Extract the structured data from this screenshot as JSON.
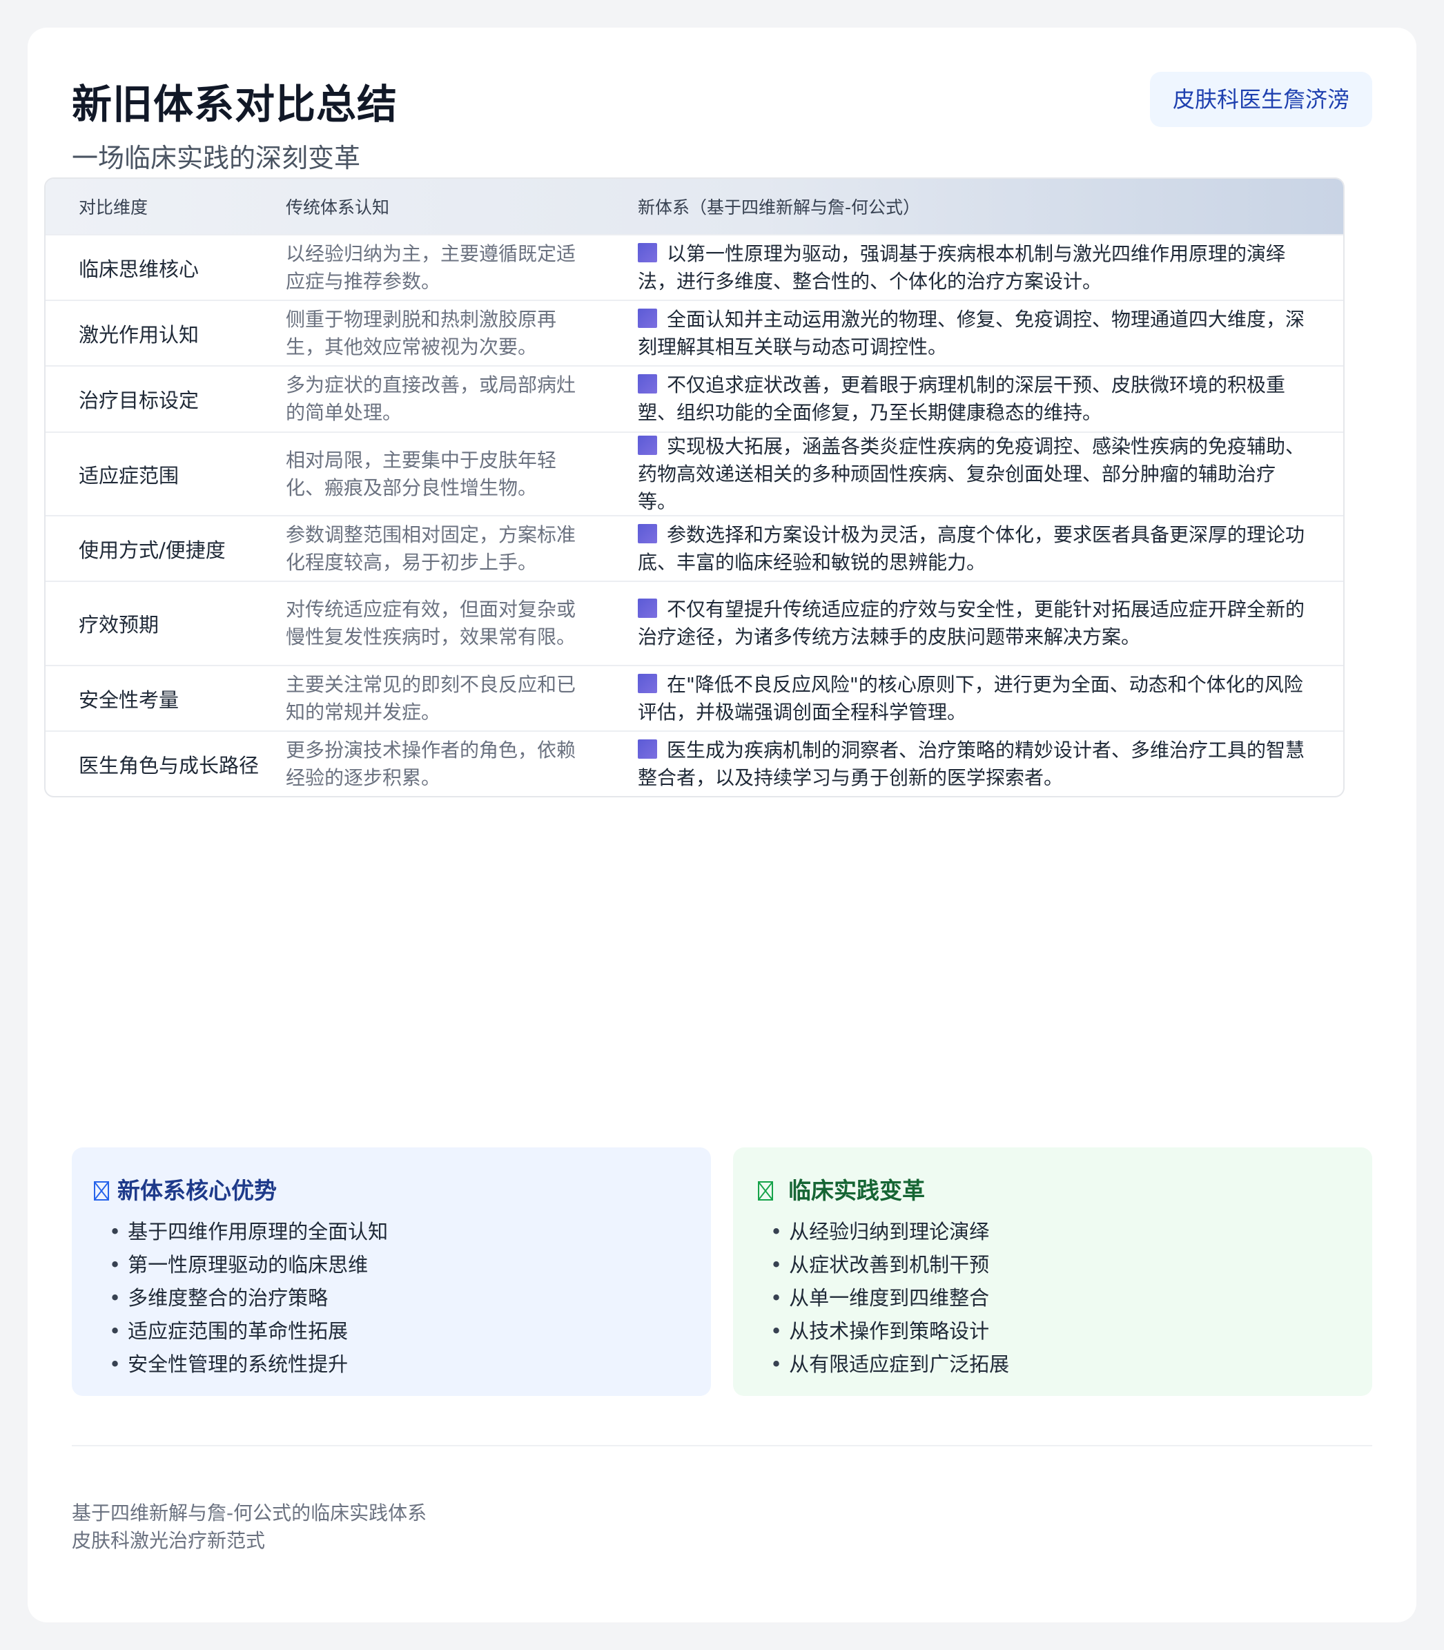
{
  "header": {
    "title": "新旧体系对比总结",
    "subtitle": "一场临床实践的深刻变革",
    "badge": "皮肤科医生詹济滂"
  },
  "table": {
    "columns": [
      "对比维度",
      "传统体系认知",
      "新体系（基于四维新解与詹-何公式）"
    ],
    "rows": [
      {
        "dimension": "临床思维核心",
        "traditional": "以经验归纳为主，主要遵循既定适应症与推荐参数。",
        "new": "以第一性原理为驱动，强调基于疾病根本机制与激光四维作用原理的演绎法，进行多维度、整合性的、个体化的治疗方案设计。"
      },
      {
        "dimension": "激光作用认知",
        "traditional": "侧重于物理剥脱和热刺激胶原再生，其他效应常被视为次要。",
        "new": "全面认知并主动运用激光的物理、修复、免疫调控、物理通道四大维度，深刻理解其相互关联与动态可调控性。"
      },
      {
        "dimension": "治疗目标设定",
        "traditional": "多为症状的直接改善，或局部病灶的简单处理。",
        "new": "不仅追求症状改善，更着眼于病理机制的深层干预、皮肤微环境的积极重塑、组织功能的全面修复，乃至长期健康稳态的维持。"
      },
      {
        "dimension": "适应症范围",
        "traditional": "相对局限，主要集中于皮肤年轻化、瘢痕及部分良性增生物。",
        "new": "实现极大拓展，涵盖各类炎症性疾病的免疫调控、感染性疾病的免疫辅助、药物高效递送相关的多种顽固性疾病、复杂创面处理、部分肿瘤的辅助治疗等。"
      },
      {
        "dimension": "使用方式/便捷度",
        "traditional": "参数调整范围相对固定，方案标准化程度较高，易于初步上手。",
        "new": "参数选择和方案设计极为灵活，高度个体化，要求医者具备更深厚的理论功底、丰富的临床经验和敏锐的思辨能力。"
      },
      {
        "dimension": "疗效预期",
        "traditional": "对传统适应症有效，但面对复杂或慢性复发性疾病时，效果常有限。",
        "new": "不仅有望提升传统适应症的疗效与安全性，更能针对拓展适应症开辟全新的治疗途径，为诸多传统方法棘手的皮肤问题带来解决方案。"
      },
      {
        "dimension": "安全性考量",
        "traditional": "主要关注常见的即刻不良反应和已知的常规并发症。",
        "new": "在\"降低不良反应风险\"的核心原则下，进行更为全面、动态和个体化的风险评估，并极端强调创面全程科学管理。"
      },
      {
        "dimension": "医生角色与成长路径",
        "traditional": "更多扮演技术操作者的角色，依赖经验的逐步积累。",
        "new": "医生成为疾病机制的洞察者、治疗策略的精妙设计者、多维治疗工具的智慧整合者，以及持续学习与勇于创新的医学探索者。"
      }
    ]
  },
  "advantages": {
    "title": "新体系核心优势",
    "items": [
      "基于四维作用原理的全面认知",
      "第一性原理驱动的临床思维",
      "多维度整合的治疗策略",
      "适应症范围的革命性拓展",
      "安全性管理的系统性提升"
    ]
  },
  "transformation": {
    "title": "临床实践变革",
    "items": [
      "从经验归纳到理论演绎",
      "从症状改善到机制干预",
      "从单一维度到四维整合",
      "从技术操作到策略设计",
      "从有限适应症到广泛拓展"
    ]
  },
  "footer": {
    "line1": "基于四维新解与詹-何公式的临床实践体系",
    "line2": "皮肤科激光治疗新范式"
  }
}
